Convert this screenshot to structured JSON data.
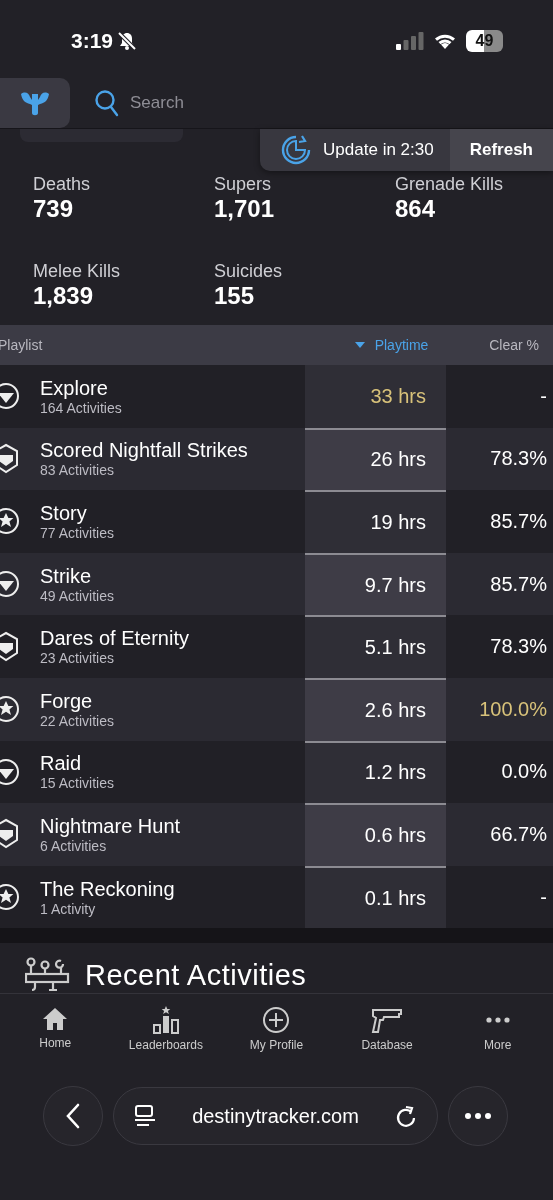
{
  "status_bar": {
    "time": "3:19",
    "battery": "49"
  },
  "header": {
    "search": {
      "placeholder": "Search"
    }
  },
  "toast": {
    "message": "Update in 2:30",
    "action": "Refresh"
  },
  "stats": [
    {
      "label": "Deaths",
      "value": "739"
    },
    {
      "label": "Supers",
      "value": "1,701"
    },
    {
      "label": "Grenade Kills",
      "value": "864"
    },
    {
      "label": "Melee Kills",
      "value": "1,839"
    },
    {
      "label": "Suicides",
      "value": "155"
    }
  ],
  "table": {
    "columns": [
      {
        "label": "Playlist",
        "selected": false
      },
      {
        "label": "Playtime",
        "selected": true
      },
      {
        "label": "Clear %",
        "selected": false
      }
    ],
    "rows": [
      {
        "name": "Explore",
        "activities": "164 Activities",
        "playtime": "33 hrs",
        "playtime_best": true,
        "clear": "-",
        "clear_best": false
      },
      {
        "name": "Scored Nightfall Strikes",
        "activities": "83 Activities",
        "playtime": "26 hrs",
        "playtime_best": false,
        "clear": "78.3%",
        "clear_best": false
      },
      {
        "name": "Story",
        "activities": "77 Activities",
        "playtime": "19 hrs",
        "playtime_best": false,
        "clear": "85.7%",
        "clear_best": false
      },
      {
        "name": "Strike",
        "activities": "49 Activities",
        "playtime": "9.7 hrs",
        "playtime_best": false,
        "clear": "85.7%",
        "clear_best": false
      },
      {
        "name": "Dares of Eternity",
        "activities": "23 Activities",
        "playtime": "5.1 hrs",
        "playtime_best": false,
        "clear": "78.3%",
        "clear_best": false
      },
      {
        "name": "Forge",
        "activities": "22 Activities",
        "playtime": "2.6 hrs",
        "playtime_best": false,
        "clear": "100.0%",
        "clear_best": true
      },
      {
        "name": "Raid",
        "activities": "15 Activities",
        "playtime": "1.2 hrs",
        "playtime_best": false,
        "clear": "0.0%",
        "clear_best": false
      },
      {
        "name": "Nightmare Hunt",
        "activities": "6 Activities",
        "playtime": "0.6 hrs",
        "playtime_best": false,
        "clear": "66.7%",
        "clear_best": false
      },
      {
        "name": "The Reckoning",
        "activities": "1 Activity",
        "playtime": "0.1 hrs",
        "playtime_best": false,
        "clear": "-",
        "clear_best": false
      }
    ]
  },
  "section": {
    "title": "Recent Activities"
  },
  "nav": [
    {
      "label": "Home"
    },
    {
      "label": "Leaderboards"
    },
    {
      "label": "My Profile"
    },
    {
      "label": "Database"
    },
    {
      "label": "More"
    }
  ],
  "browser": {
    "url": "destinytracker.com"
  }
}
